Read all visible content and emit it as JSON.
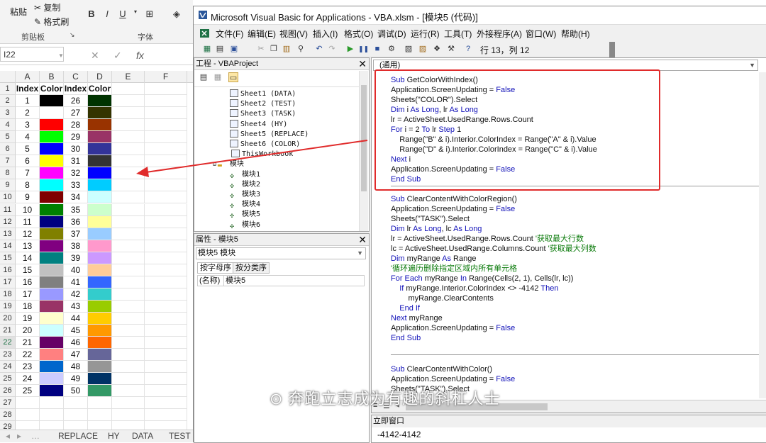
{
  "excel": {
    "ribbon": {
      "paste": "粘贴",
      "copy": "复制",
      "format_painter": "格式刷",
      "clipboard_group": "剪贴板",
      "font_group": "字体",
      "bold": "B",
      "italic": "I",
      "underline": "U"
    },
    "name_box": "I22",
    "formula_fx": "fx",
    "columns": [
      "A",
      "B",
      "C",
      "D",
      "E",
      "F"
    ],
    "header_row": [
      "Index",
      "Color",
      "Index",
      "Color"
    ],
    "rows": [
      {
        "a": "1",
        "b": "#000000",
        "c": "26",
        "d": "#003300"
      },
      {
        "a": "2",
        "b": "#ffffff",
        "c": "27",
        "d": "#333300"
      },
      {
        "a": "3",
        "b": "#ff0000",
        "c": "28",
        "d": "#993300"
      },
      {
        "a": "4",
        "b": "#00ff00",
        "c": "29",
        "d": "#993366"
      },
      {
        "a": "5",
        "b": "#0000ff",
        "c": "30",
        "d": "#333399"
      },
      {
        "a": "6",
        "b": "#ffff00",
        "c": "31",
        "d": "#333333"
      },
      {
        "a": "7",
        "b": "#ff00ff",
        "c": "32",
        "d": "#0000ff"
      },
      {
        "a": "8",
        "b": "#00ffff",
        "c": "33",
        "d": "#00ccff"
      },
      {
        "a": "9",
        "b": "#800000",
        "c": "34",
        "d": "#ccffff"
      },
      {
        "a": "10",
        "b": "#008000",
        "c": "35",
        "d": "#ccffcc"
      },
      {
        "a": "11",
        "b": "#000080",
        "c": "36",
        "d": "#ffff99"
      },
      {
        "a": "12",
        "b": "#808000",
        "c": "37",
        "d": "#99ccff"
      },
      {
        "a": "13",
        "b": "#800080",
        "c": "38",
        "d": "#ff99cc"
      },
      {
        "a": "14",
        "b": "#008080",
        "c": "39",
        "d": "#cc99ff"
      },
      {
        "a": "15",
        "b": "#c0c0c0",
        "c": "40",
        "d": "#ffcc99"
      },
      {
        "a": "16",
        "b": "#808080",
        "c": "41",
        "d": "#3366ff"
      },
      {
        "a": "17",
        "b": "#9999ff",
        "c": "42",
        "d": "#33cccc"
      },
      {
        "a": "18",
        "b": "#993366",
        "c": "43",
        "d": "#99cc00"
      },
      {
        "a": "19",
        "b": "#ffffcc",
        "c": "44",
        "d": "#ffcc00"
      },
      {
        "a": "20",
        "b": "#ccffff",
        "c": "45",
        "d": "#ff9900"
      },
      {
        "a": "21",
        "b": "#660066",
        "c": "46",
        "d": "#ff6600"
      },
      {
        "a": "22",
        "b": "#ff8080",
        "c": "47",
        "d": "#666699"
      },
      {
        "a": "23",
        "b": "#0066cc",
        "c": "48",
        "d": "#969696"
      },
      {
        "a": "24",
        "b": "#ccccff",
        "c": "49",
        "d": "#003366"
      },
      {
        "a": "25",
        "b": "#000080",
        "c": "50",
        "d": "#339966"
      }
    ],
    "empty_rows": [
      "27",
      "28",
      "29"
    ],
    "sheet_tabs": [
      "REPLACE",
      "HY",
      "DATA",
      "TEST"
    ]
  },
  "vbe": {
    "title": "Microsoft Visual Basic for Applications - VBA.xlsm - [模块5 (代码)]",
    "menus": [
      "文件(F)",
      "编辑(E)",
      "视图(V)",
      "插入(I)",
      "格式(O)",
      "调试(D)",
      "运行(R)",
      "工具(T)",
      "外接程序(A)",
      "窗口(W)",
      "帮助(H)"
    ],
    "cursor_position": "行 13，列 12",
    "project_pane": {
      "title": "工程 - VBAProject",
      "sheets": [
        "Sheet1 (DATA)",
        "Sheet2 (TEST)",
        "Sheet3 (TASK)",
        "Sheet4 (HY)",
        "Sheet5 (REPLACE)",
        "Sheet6 (COLOR)",
        "ThisWorkbook"
      ],
      "modules_folder": "模块",
      "modules": [
        "模块1",
        "模块2",
        "模块3",
        "模块4",
        "模块5",
        "模块6"
      ]
    },
    "properties_pane": {
      "title": "属性 - 模块5",
      "object": "模块5 模块",
      "tab_alpha": "按字母序",
      "tab_category": "按分类序",
      "name_key": "(名称)",
      "name_value": "模块5"
    },
    "code_combo": "(通用)",
    "immediate": {
      "title": "立即窗口",
      "value": "-4142-4142"
    },
    "watermark": "奔跑立志成为有趣的斜杠人士"
  }
}
